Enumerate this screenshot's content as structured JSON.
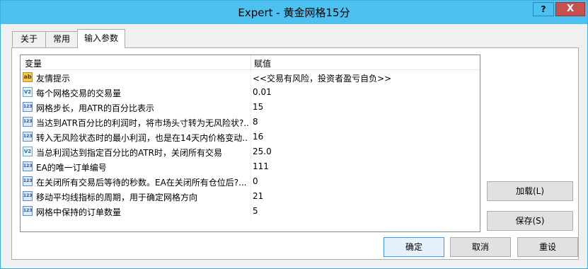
{
  "window": {
    "title": "Expert - 黄金网格15分",
    "help_label": "?",
    "close_label": "X"
  },
  "tabs": [
    {
      "label": "关于"
    },
    {
      "label": "常用"
    },
    {
      "label": "输入参数"
    }
  ],
  "grid": {
    "columns": [
      "变量",
      "赋值"
    ],
    "rows": [
      {
        "icon": "ab-string-icon",
        "icon_text": "ab",
        "name": "友情提示",
        "value": "<<交易有风险，投资者盈亏自负>>"
      },
      {
        "icon": "double-value-icon",
        "icon_text": "V2",
        "name": "每个网格交易的交易量",
        "value": "0.01"
      },
      {
        "icon": "integer-value-icon",
        "icon_text": "123",
        "name": "网格步长，用ATR的百分比表示",
        "value": "15"
      },
      {
        "icon": "integer-value-icon",
        "icon_text": "123",
        "name": "当达到ATR百分比的利润时，将市场头寸转为无风险状?...",
        "value": "8"
      },
      {
        "icon": "integer-value-icon",
        "icon_text": "123",
        "name": "转入无风险状态时的最小利润，也是在14天内价格变动...",
        "value": "16"
      },
      {
        "icon": "double-value-icon",
        "icon_text": "V2",
        "name": "当总利润达到指定百分比的ATR时，关闭所有交易",
        "value": "25.0"
      },
      {
        "icon": "integer-value-icon",
        "icon_text": "123",
        "name": "EA的唯一订单编号",
        "value": "111"
      },
      {
        "icon": "integer-value-icon",
        "icon_text": "123",
        "name": "在关闭所有交易后等待的秒数。EA在关闭所有仓位后?...",
        "value": "0"
      },
      {
        "icon": "integer-value-icon",
        "icon_text": "123",
        "name": "移动平均线指标的周期，用于确定网格方向",
        "value": "21"
      },
      {
        "icon": "integer-value-icon",
        "icon_text": "123",
        "name": "网格中保持的订单数量",
        "value": "5"
      }
    ]
  },
  "buttons": {
    "load": "加载(L)",
    "save": "保存(S)",
    "ok": "确定",
    "cancel": "取消",
    "reset": "重设"
  }
}
